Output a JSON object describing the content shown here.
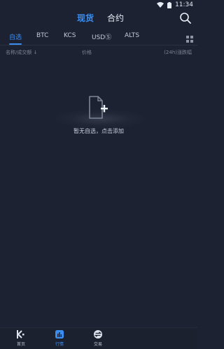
{
  "status": {
    "time": "11:34"
  },
  "topnav": {
    "tabs": [
      {
        "label": "现货"
      },
      {
        "label": "合约"
      }
    ]
  },
  "market_tabs": [
    {
      "label": "自选"
    },
    {
      "label": "BTC"
    },
    {
      "label": "KCS"
    },
    {
      "label": "USDⓈ"
    },
    {
      "label": "ALTS"
    }
  ],
  "column_headers": {
    "name": "名称/成交额 ↓",
    "price": "价格",
    "change": "(24h)涨跌幅"
  },
  "empty_state": {
    "message": "暂无自选，点击添加"
  },
  "bottom_nav": [
    {
      "label": "首页"
    },
    {
      "label": "行情"
    },
    {
      "label": "交易"
    }
  ],
  "colors": {
    "accent": "#3a8ef0",
    "background": "#1d2232"
  }
}
